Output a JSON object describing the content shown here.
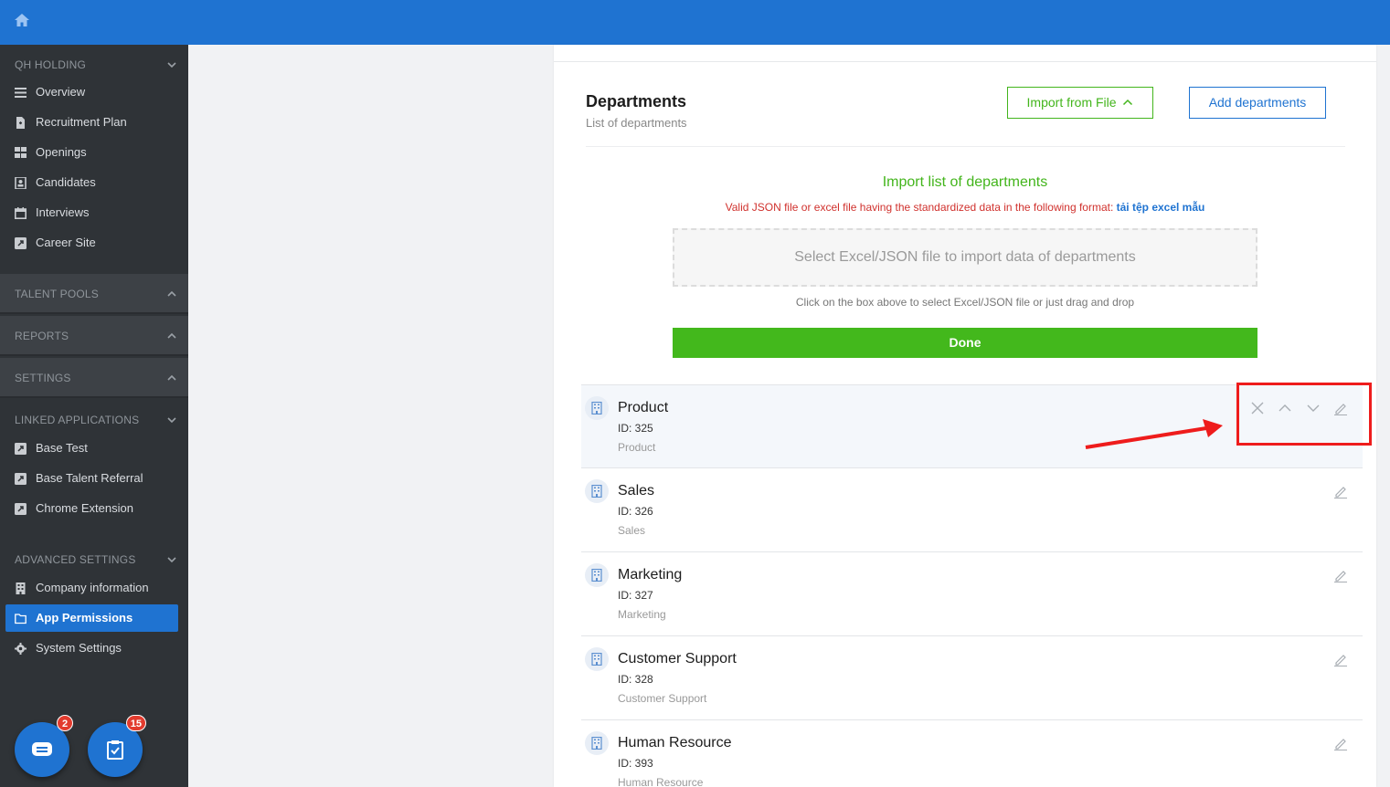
{
  "colors": {
    "primary": "#1f73d1",
    "success": "#43b51c",
    "danger": "#d0312d",
    "sidebar": "#2f3337"
  },
  "topbar": {
    "home_icon": "home-icon"
  },
  "sidebar": {
    "sections": [
      {
        "title": "QH HOLDING",
        "expanded": true,
        "items": [
          {
            "label": "Overview",
            "icon": "menu-icon"
          },
          {
            "label": "Recruitment Plan",
            "icon": "document-plus-icon"
          },
          {
            "label": "Openings",
            "icon": "grid-icon"
          },
          {
            "label": "Candidates",
            "icon": "contact-card-icon"
          },
          {
            "label": "Interviews",
            "icon": "calendar-icon"
          },
          {
            "label": "Career Site",
            "icon": "external-link-icon"
          }
        ]
      },
      {
        "title": "TALENT POOLS",
        "expanded": false
      },
      {
        "title": "REPORTS",
        "expanded": false
      },
      {
        "title": "SETTINGS",
        "expanded": false
      },
      {
        "title": "LINKED APPLICATIONS",
        "expanded": true,
        "items": [
          {
            "label": "Base Test",
            "icon": "external-link-icon"
          },
          {
            "label": "Base Talent Referral",
            "icon": "external-link-icon"
          },
          {
            "label": "Chrome Extension",
            "icon": "external-link-icon"
          }
        ]
      },
      {
        "title": "ADVANCED SETTINGS",
        "expanded": true,
        "items": [
          {
            "label": "Company information",
            "icon": "building-icon"
          },
          {
            "label": "App Permissions",
            "icon": "folder-icon",
            "active": true
          },
          {
            "label": "System Settings",
            "icon": "gear-icon"
          }
        ]
      }
    ],
    "fabs": [
      {
        "icon": "chat-icon",
        "badge": "2"
      },
      {
        "icon": "clipboard-check-icon",
        "badge": "15"
      }
    ]
  },
  "main": {
    "title": "Departments",
    "subtitle": "List of departments",
    "import_button": "Import from File",
    "add_button": "Add departments",
    "import": {
      "title": "Import list of departments",
      "note": "Valid JSON file or excel file having the standardized data in the following format: ",
      "note_link": "tải tệp excel mẫu",
      "dropzone": "Select Excel/JSON file to import data of departments",
      "hint": "Click on the box above to select Excel/JSON file or just drag and drop",
      "done": "Done"
    },
    "departments": [
      {
        "name": "Product",
        "id": "ID: 325",
        "desc": "Product",
        "selected": true
      },
      {
        "name": "Sales",
        "id": "ID: 326",
        "desc": "Sales"
      },
      {
        "name": "Marketing",
        "id": "ID: 327",
        "desc": "Marketing"
      },
      {
        "name": "Customer Support",
        "id": "ID: 328",
        "desc": "Customer Support"
      },
      {
        "name": "Human Resource",
        "id": "ID: 393",
        "desc": "Human Resource"
      }
    ]
  }
}
